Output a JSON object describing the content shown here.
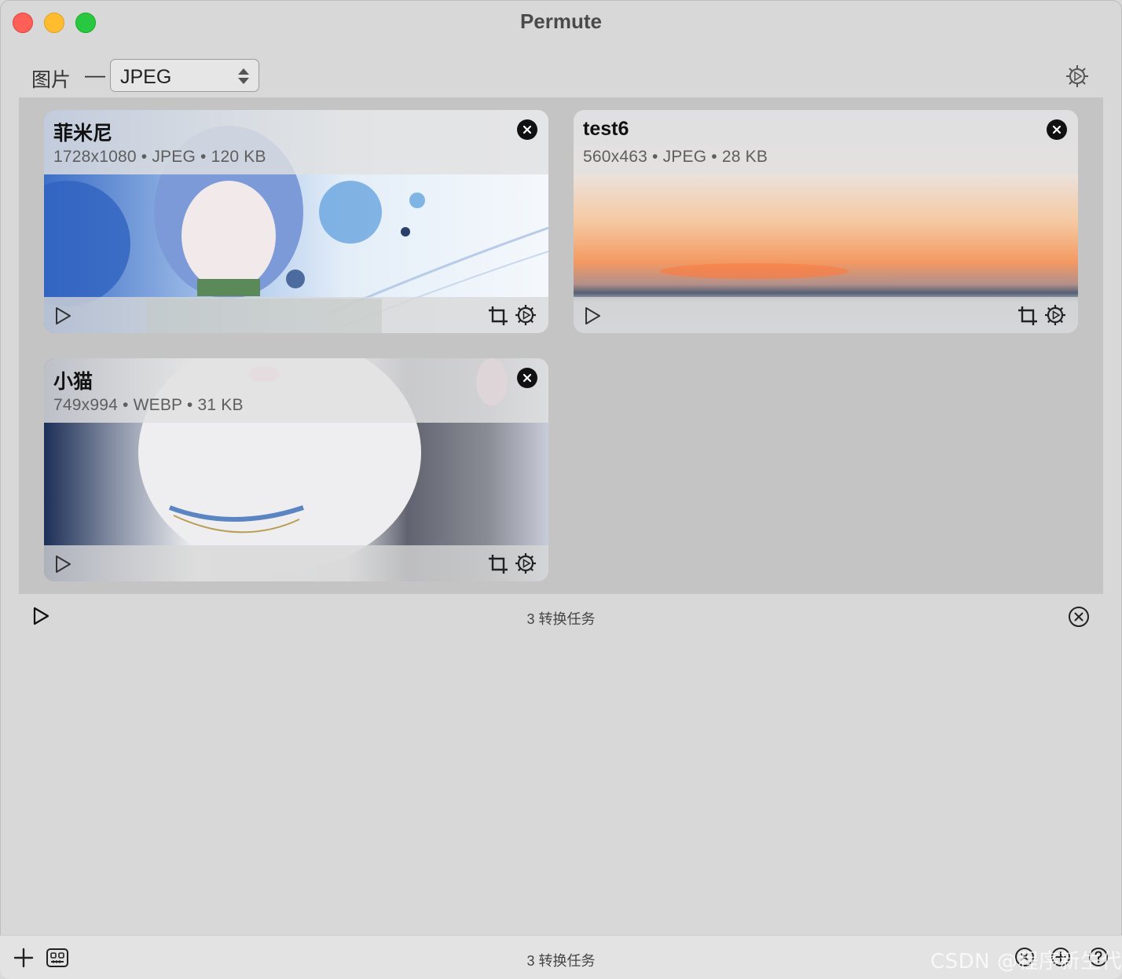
{
  "window": {
    "title": "Permute"
  },
  "toolbar": {
    "media_type_label": "图片",
    "dash": "—",
    "format_value": "JPEG"
  },
  "items": [
    {
      "name": "菲米尼",
      "meta": "1728x1080 • JPEG • 120 KB"
    },
    {
      "name": "test6",
      "meta": "560x463 • JPEG • 28 KB"
    },
    {
      "name": "小猫",
      "meta": "749x994 • WEBP • 31 KB"
    }
  ],
  "status": {
    "task_count": "3 转换任务"
  },
  "bottom_bar": {
    "task_count": "3 转换任务",
    "watermark": "CSDN @程序新生代"
  },
  "colors": {
    "traffic_red": "#fe5f57",
    "traffic_yellow": "#febc2e",
    "traffic_green": "#28c840",
    "list_background": "#c4c4c4"
  }
}
